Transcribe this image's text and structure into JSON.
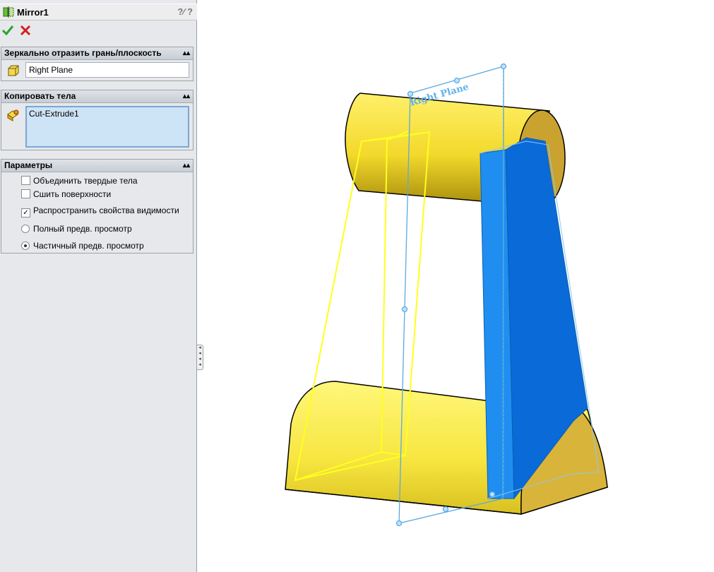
{
  "feature": {
    "title": "Mirror1",
    "help_glyphs": "?⁄ ?"
  },
  "actions": {
    "ok": "OK",
    "cancel": "Cancel"
  },
  "mirror_face": {
    "header": "Зеркально отразить грань/плоскость",
    "value": "Right Plane"
  },
  "copy_bodies": {
    "header": "Копировать тела",
    "items": [
      "Cut-Extrude1"
    ]
  },
  "parameters": {
    "header": "Параметры",
    "options": [
      {
        "label": "Объединить твердые тела",
        "type": "checkbox",
        "checked": false
      },
      {
        "label": "Сшить поверхности",
        "type": "checkbox",
        "checked": false
      },
      {
        "label": "Распространить свойства видимости",
        "type": "checkbox",
        "checked": true
      },
      {
        "label": "Полный предв. просмотр",
        "type": "radio",
        "checked": false
      },
      {
        "label": "Частичный предв. просмотр",
        "type": "radio",
        "checked": true
      }
    ]
  },
  "viewport": {
    "plane_label": "Right Plane"
  },
  "colors": {
    "body": "#f7e53f",
    "selected_face": "#1b86e6",
    "plane": "#5aa9e0",
    "preview": "#ffff33"
  }
}
